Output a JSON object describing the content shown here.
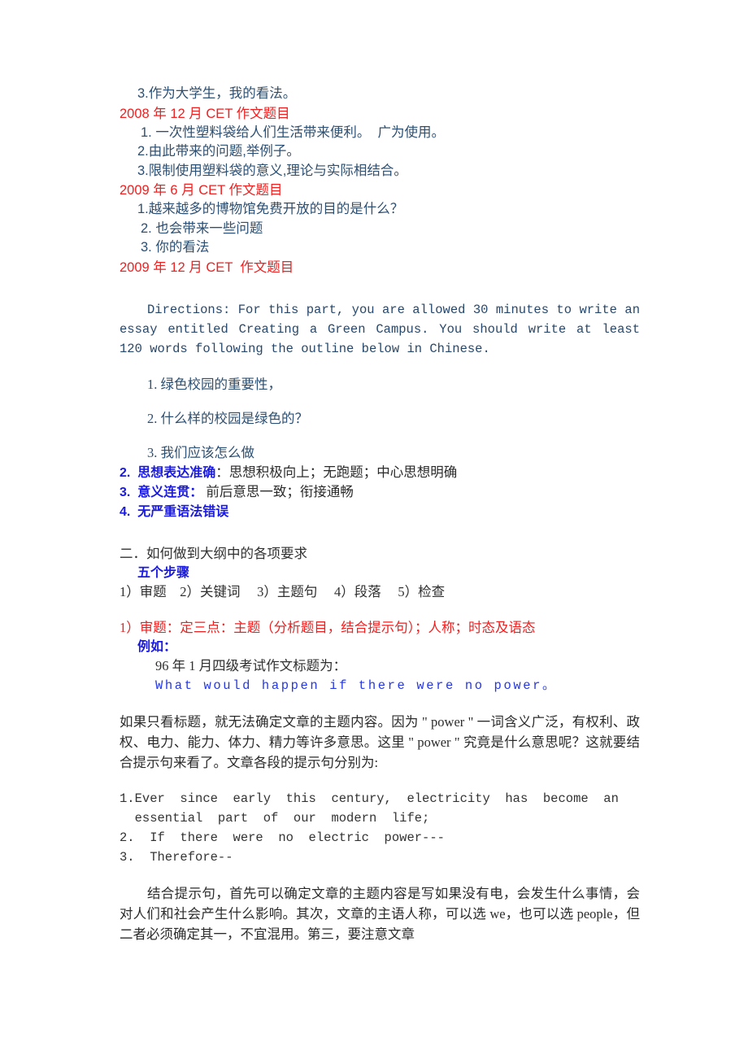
{
  "document": {
    "colors": {
      "heading_red": "#ef2020",
      "body_slate_blue": "#2d4f72",
      "emphasis_blue": "#1a1ae0",
      "mono_blue": "#2638e0",
      "body_dark": "#2b2b2b",
      "page_background": "#ffffff"
    },
    "top_outline": {
      "carryover_item": "3.作为大学生，我的看法。"
    },
    "sections": [
      {
        "heading": "2008 年 12 月 CET 作文题目",
        "items": [
          "1. 一次性塑料袋给人们生活带来便利。  广为使用。",
          "2.由此带来的问题,举例子。",
          "3.限制使用塑料袋的意义,理论与实际相结合。"
        ]
      },
      {
        "heading": "2009 年 6 月 CET 作文题目",
        "items": [
          "1.越来越多的博物馆免费开放的目的是什么？",
          "2. 也会带来一些问题",
          "3. 你的看法"
        ]
      },
      {
        "heading": "2009 年 12 月 CET  作文题目",
        "items": []
      }
    ],
    "directions": {
      "text": "Directions: For this part, you are allowed 30 minutes to write an essay entitled Creating a Green Campus. You should write at least 120 words following the outline below in Chinese."
    },
    "green_campus_outline": [
      "1. 绿色校园的重要性，",
      "2. 什么样的校园是绿色的？",
      "3. 我们应该怎么做"
    ],
    "criteria": [
      {
        "number": "2.",
        "bold": "思想表达准确",
        "rest": "：思想积极向上；无跑题；中心思想明确"
      },
      {
        "number": "3.",
        "bold": "意义连贯：",
        "rest": " 前后意思一致；衔接通畅"
      },
      {
        "number": "4.",
        "bold": "无严重语法错误",
        "rest": ""
      }
    ],
    "section_two": {
      "heading": "二．如何做到大纲中的各项要求",
      "subheading": "五个步骤",
      "steps_line": "1）审题    2）关键词     3）主题句     4）段落     5）检查",
      "step_one_red": "1）审题：定三点：主题（分析题目，结合提示句）；人称；时态及语态",
      "example_label": "例如：",
      "example_intro": "96 年 1 月四级考试作文标题为：",
      "example_title": "What would happen if there were no power。"
    },
    "analysis_paragraph": "如果只看标题，就无法确定文章的主题内容。因为 \" power \" 一词含义广泛，有权利、政权、电力、能力、体力、精力等许多意思。这里 \" power \" 究竟是什么意思呢？这就要结合提示句来看了。文章各段的提示句分别为:",
    "hint_sentences": [
      "1.Ever  since  early  this  century,  electricity  has  become  an",
      "  essential  part  of  our  modern  life;",
      "2.  If  there  were  no  electric  power---",
      "3.  Therefore--"
    ],
    "closing_paragraph": "结合提示句，首先可以确定文章的主题内容是写如果没有电，会发生什么事情，会对人们和社会产生什么影响。其次，文章的主语人称，可以选 we，也可以选 people，但二者必须确定其一，不宜混用。第三，要注意文章"
  }
}
